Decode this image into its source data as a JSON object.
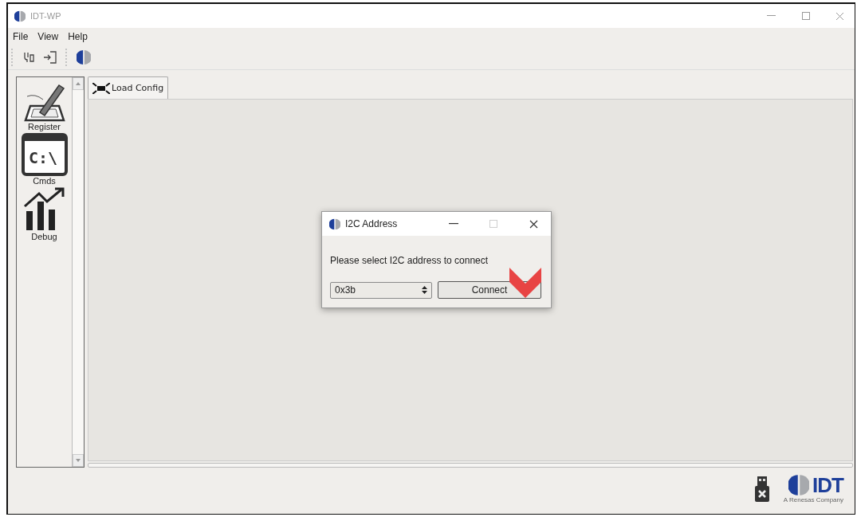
{
  "window": {
    "title": "IDT-WP"
  },
  "menu": [
    "File",
    "View",
    "Help"
  ],
  "sidebar": {
    "items": [
      {
        "label": "Register",
        "kind": "pen"
      },
      {
        "label": "Cmds",
        "kind": "terminal",
        "icon_text": "C:\\"
      },
      {
        "label": "Debug",
        "kind": "chart"
      }
    ]
  },
  "load_config_button": "Load Config",
  "dialog": {
    "title": "I2C Address",
    "maximize_disabled": true,
    "message": "Please select I2C address to connect",
    "address": "0x3b",
    "connect_button": "Connect"
  },
  "logo": {
    "name": "IDT",
    "tagline": "A Renesas Company"
  }
}
